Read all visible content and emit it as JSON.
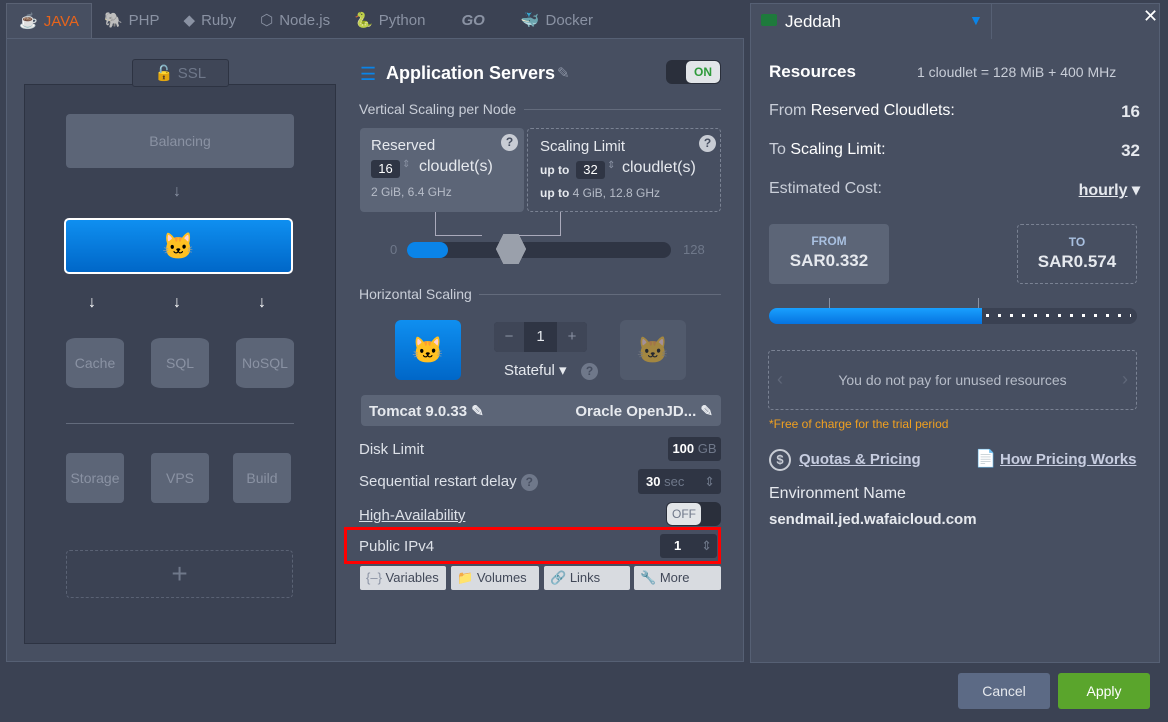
{
  "tabs": [
    {
      "label": "JAVA",
      "icon": "java-icon"
    },
    {
      "label": "PHP",
      "icon": "php-icon"
    },
    {
      "label": "Ruby",
      "icon": "ruby-icon"
    },
    {
      "label": "Node.js",
      "icon": "nodejs-icon"
    },
    {
      "label": "Python",
      "icon": "python-icon"
    },
    {
      "label": "GO",
      "icon": "go-icon"
    },
    {
      "label": "Docker",
      "icon": "docker-icon"
    }
  ],
  "topology": {
    "ssl": "SSL",
    "balancing": "Balancing",
    "cache": "Cache",
    "sql": "SQL",
    "nosql": "NoSQL",
    "storage": "Storage",
    "vps": "VPS",
    "build": "Build",
    "add": "+"
  },
  "app": {
    "title": "Application Servers",
    "toggle": "ON",
    "vertical_label": "Vertical Scaling per Node",
    "reserved": {
      "title": "Reserved",
      "value": "16",
      "unit": "cloudlet(s)",
      "info": "2 GiB, 6.4 GHz"
    },
    "limit": {
      "title": "Scaling Limit",
      "prefix": "up to",
      "value": "32",
      "unit": "cloudlet(s)",
      "info_prefix": "up to",
      "info": "4 GiB, 12.8 GHz"
    },
    "slider_min": "0",
    "slider_max": "128",
    "slider_reserved": 16,
    "slider_limit": 32,
    "horizontal_label": "Horizontal Scaling",
    "minus": "−",
    "nodes": "1",
    "plus": "+",
    "mode": "Stateful",
    "server": "Tomcat 9.0.33",
    "engine": "Oracle OpenJD...",
    "disk_label": "Disk Limit",
    "disk_value": "100",
    "disk_unit": "GB",
    "restart_label": "Sequential restart delay",
    "restart_value": "30",
    "restart_unit": "sec",
    "ha_label": "High-Availability",
    "ha_toggle": "OFF",
    "ipv4_label": "Public IPv4",
    "ipv4_value": "1",
    "buttons": [
      "Variables",
      "Volumes",
      "Links",
      "More"
    ]
  },
  "region": {
    "name": "Jeddah",
    "flag_color": "#1e7a3c"
  },
  "resources": {
    "title": "Resources",
    "formula": "1 cloudlet = 128 MiB + 400 MHz",
    "from_label": "From",
    "from_label2": "Reserved Cloudlets:",
    "from_value": "16",
    "to_label": "To",
    "to_label2": "Scaling Limit:",
    "to_value": "32",
    "cost_label": "Estimated Cost:",
    "cost_period": "hourly",
    "price_from_label": "FROM",
    "price_from": "SAR0.332",
    "price_to_label": "TO",
    "price_to": "SAR0.574",
    "price_fill_percent": 58,
    "carousel": "You do not pay for unused resources",
    "trial": "*Free of charge for the trial period",
    "quotas": "Quotas & Pricing",
    "how": "How Pricing Works",
    "env_label": "Environment Name",
    "env_value": "sendmail.jed.wafaicloud.com"
  },
  "footer": {
    "cancel": "Cancel",
    "apply": "Apply"
  },
  "colors": {
    "accent": "#0a84e8",
    "apply": "#5aa52c",
    "highlight": "#ff0000",
    "trial": "#f0a020"
  }
}
